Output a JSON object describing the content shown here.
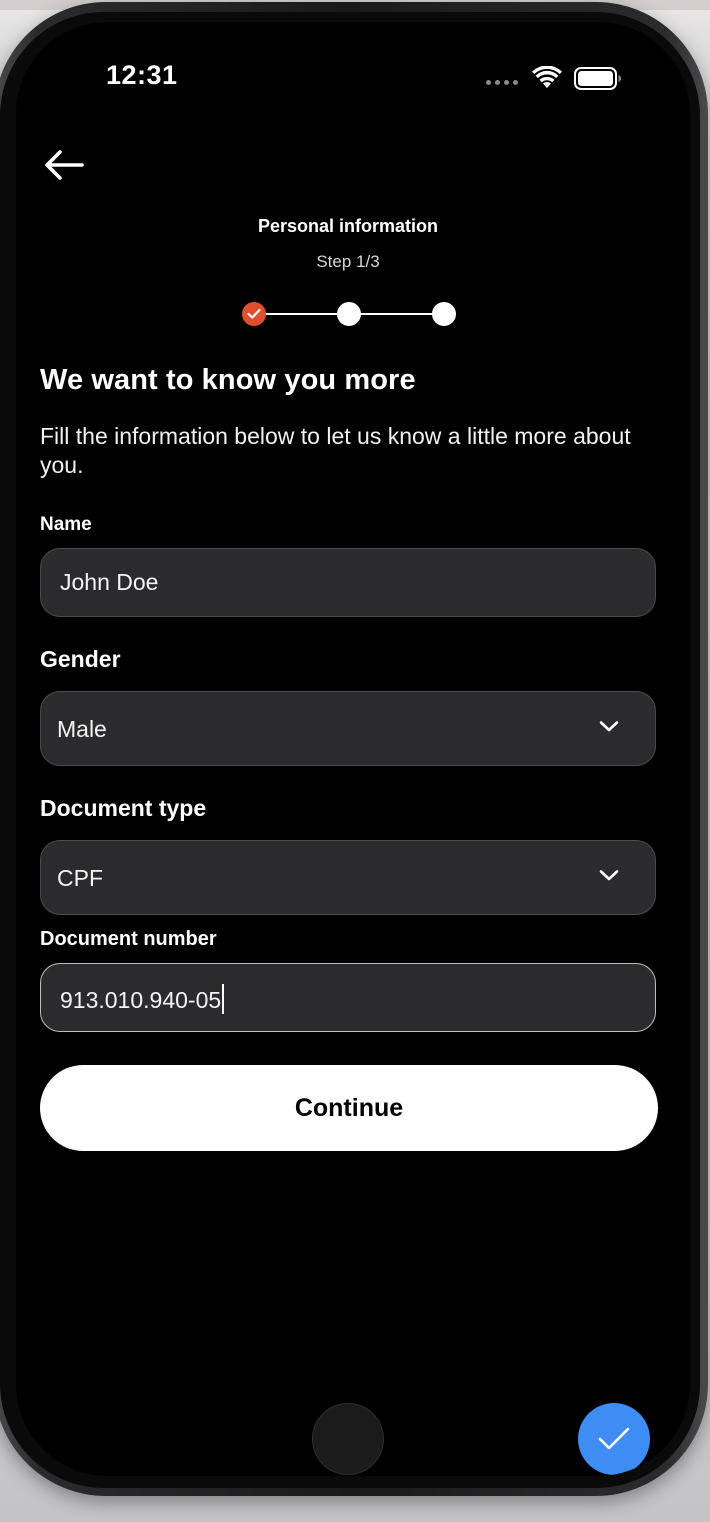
{
  "status_bar": {
    "time": "12:31"
  },
  "header": {
    "title": "Personal information",
    "step": "Step 1/3",
    "progress": {
      "current_step": 1,
      "total_steps": 3,
      "completed_steps": 1
    }
  },
  "intro": {
    "heading": "We want to know you more",
    "description": "Fill the information below to let us know a little more about you."
  },
  "form": {
    "name": {
      "label": "Name",
      "value": "John Doe"
    },
    "gender": {
      "label": "Gender",
      "value": "Male"
    },
    "document_type": {
      "label": "Document type",
      "value": "CPF"
    },
    "document_number": {
      "label": "Document number",
      "value": "913.010.940-05"
    }
  },
  "actions": {
    "continue_label": "Continue"
  },
  "colors": {
    "background": "#000000",
    "field_background": "#2b2b2d",
    "step_done": "#e1502e",
    "fab": "#3d8df5",
    "button": "#ffffff"
  },
  "icons": [
    "back-arrow-icon",
    "checkmark-icon",
    "chevron-down-icon",
    "wifi-icon",
    "battery-icon",
    "cellular-signal-icon"
  ]
}
